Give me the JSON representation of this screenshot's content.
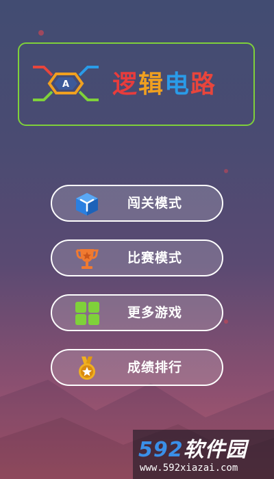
{
  "app": {
    "title": "逻辑电路",
    "logo_letter": "A",
    "title_colors": [
      "#e83c3c",
      "#f0a020",
      "#2a9be8",
      "#e8453c"
    ]
  },
  "menu": [
    {
      "id": "level",
      "label": "闯关模式",
      "icon": "cube-icon"
    },
    {
      "id": "contest",
      "label": "比赛模式",
      "icon": "trophy-icon"
    },
    {
      "id": "more",
      "label": "更多游戏",
      "icon": "grid-icon"
    },
    {
      "id": "rank",
      "label": "成绩排行",
      "icon": "medal-icon"
    }
  ],
  "watermark": {
    "brand_num": "592",
    "brand_text": "软件园",
    "url": "www.592xiazai.com"
  },
  "colors": {
    "accent_green": "#7fd13a",
    "bg_top": "#424c72",
    "bg_bottom": "#b45a6c"
  }
}
